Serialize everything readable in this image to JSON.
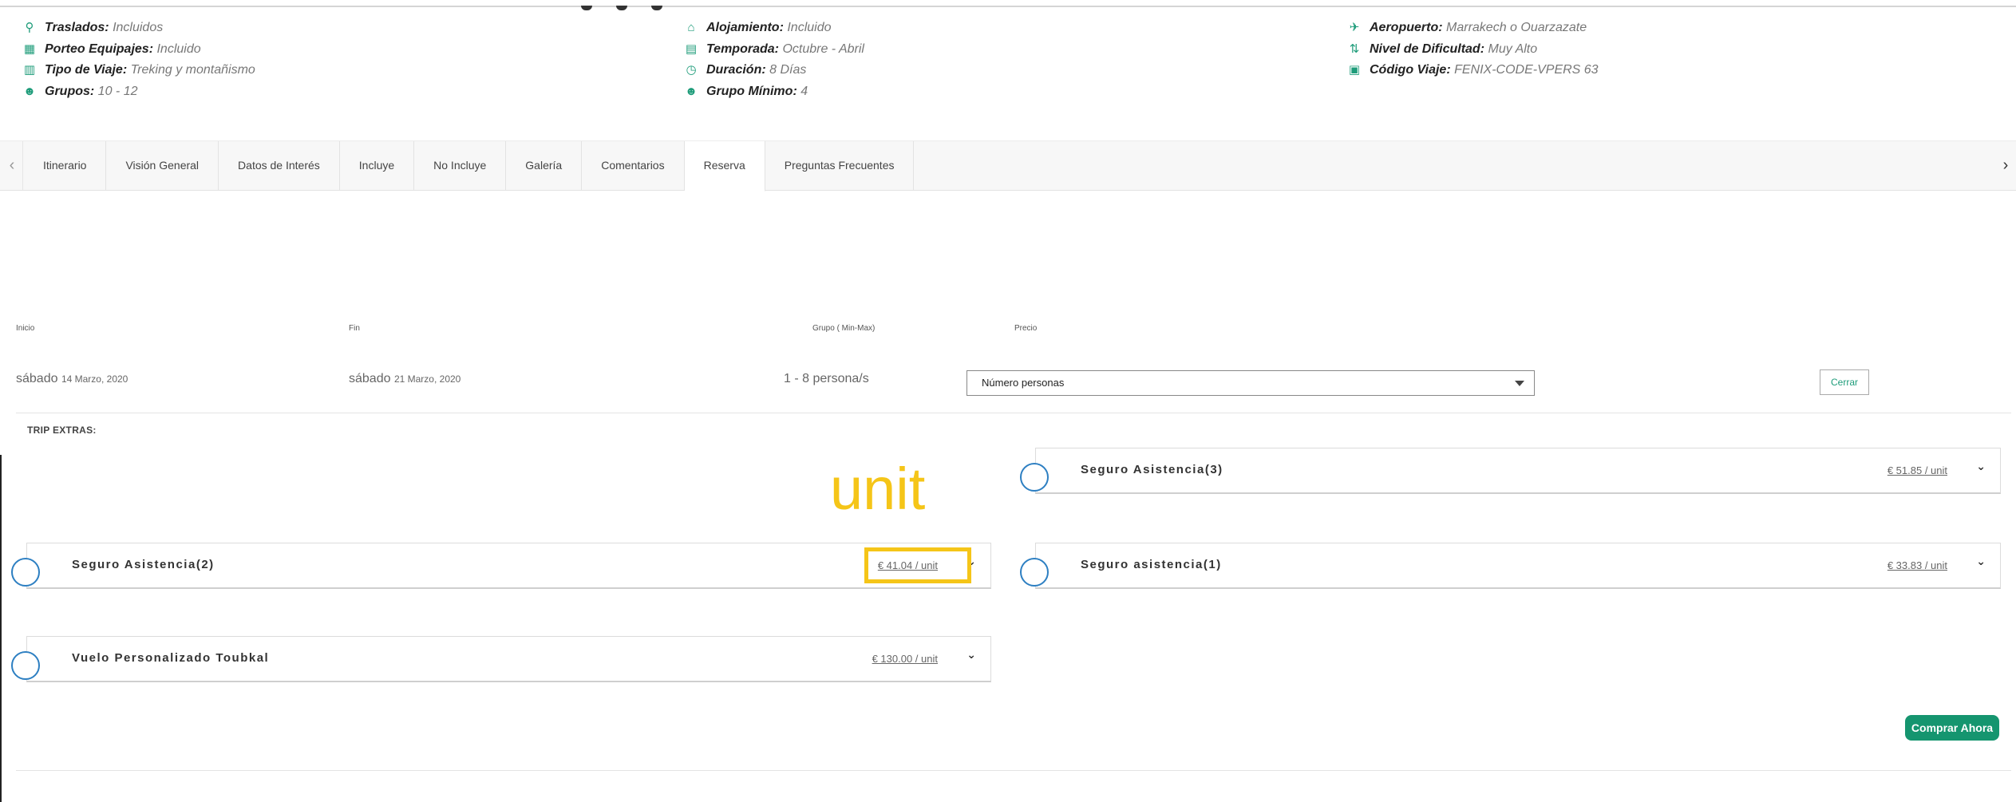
{
  "info": {
    "col1": [
      {
        "icon": "map-pin-icon",
        "glyph": "⚲",
        "key": "Traslados",
        "value": "Incluidos"
      },
      {
        "icon": "luggage-icon",
        "glyph": "▦",
        "key": "Porteo Equipajes",
        "value": "Incluido"
      },
      {
        "icon": "map-icon",
        "glyph": "▥",
        "key": "Tipo de Viaje",
        "value": "Treking y montañismo"
      },
      {
        "icon": "group-icon",
        "glyph": "☻",
        "key": "Grupos",
        "value": "10 - 12"
      }
    ],
    "col2": [
      {
        "icon": "home-icon",
        "glyph": "⌂",
        "key": "Alojamiento",
        "value": "Incluido"
      },
      {
        "icon": "calendar-icon",
        "glyph": "▤",
        "key": "Temporada",
        "value": "Octubre - Abril"
      },
      {
        "icon": "clock-icon",
        "glyph": "◷",
        "key": "Duración",
        "value": "8 Días"
      },
      {
        "icon": "group-icon",
        "glyph": "☻",
        "key": "Grupo Mínimo",
        "value": "4"
      }
    ],
    "col3": [
      {
        "icon": "plane-icon",
        "glyph": "✈",
        "key": "Aeropuerto",
        "value": "Marrakech o Ouarzazate"
      },
      {
        "icon": "difficulty-icon",
        "glyph": "⇅",
        "key": "Nivel de Dificultad",
        "value": "Muy Alto"
      },
      {
        "icon": "qr-code-icon",
        "glyph": "▣",
        "key": "Código Viaje",
        "value": "FENIX-CODE-VPERS 63"
      }
    ]
  },
  "tabs": [
    "Itinerario",
    "Visión General",
    "Datos de Interés",
    "Incluye",
    "No Incluye",
    "Galería",
    "Comentarios",
    "Reserva",
    "Preguntas Frecuentes"
  ],
  "active_tab": "Reserva",
  "booking": {
    "headers": {
      "inicio": "Inicio",
      "fin": "Fin",
      "grupo": "Grupo ( Min-Max)",
      "precio": "Precio"
    },
    "start_day": "sábado",
    "start_date": "14 Marzo, 2020",
    "end_day": "sábado",
    "end_date": "21 Marzo, 2020",
    "group": "1 - 8 persona/s",
    "select_value": "Número personas",
    "close_label": "Cerrar"
  },
  "trip_extras_label": "TRIP EXTRAS:",
  "annotation_text": "unit",
  "extras": [
    {
      "name": "Seguro Asistencia(3)",
      "price": "€ 51.85 / unit"
    },
    {
      "name": "Seguro Asistencia(2)",
      "price": "€ 41.04 / unit"
    },
    {
      "name": "Seguro asistencia(1)",
      "price": "€ 33.83 / unit"
    },
    {
      "name": "Vuelo Personalizado Toubkal",
      "price": "€ 130.00 / unit"
    }
  ],
  "buy_label": "Comprar Ahora"
}
